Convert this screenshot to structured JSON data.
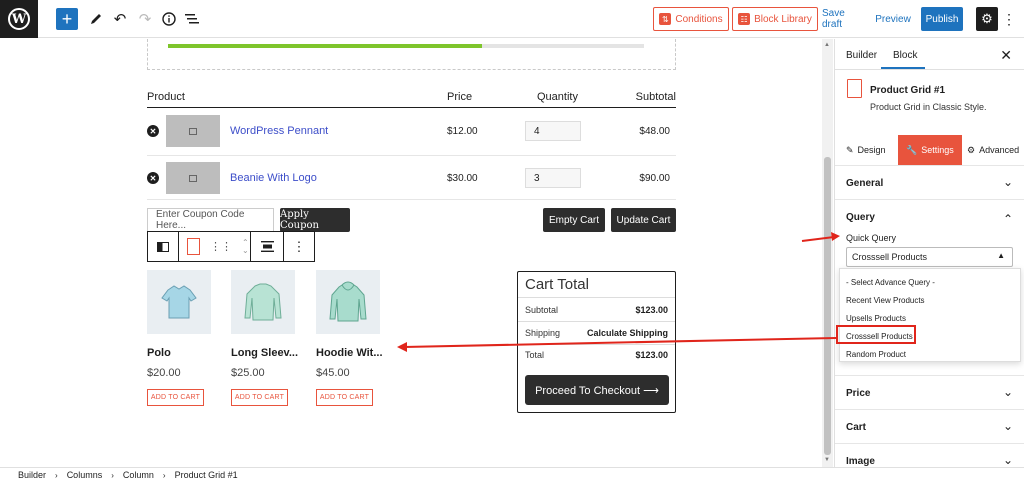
{
  "toolbar": {
    "conditions_label": "Conditions",
    "block_library_label": "Block Library",
    "save_draft_label": "Save draft",
    "preview_label": "Preview",
    "publish_label": "Publish"
  },
  "progress": {
    "fraction": 0.66
  },
  "cart": {
    "headers": {
      "product": "Product",
      "price": "Price",
      "quantity": "Quantity",
      "subtotal": "Subtotal"
    },
    "rows": [
      {
        "name": "WordPress Pennant",
        "price": "$12.00",
        "qty": "4",
        "subtotal": "$48.00"
      },
      {
        "name": "Beanie With Logo",
        "price": "$30.00",
        "qty": "3",
        "subtotal": "$90.00"
      }
    ],
    "coupon_placeholder": "Enter Coupon Code Here...",
    "apply_coupon": "Apply Coupon",
    "empty_cart": "Empty Cart",
    "update_cart": "Update Cart"
  },
  "products": [
    {
      "name": "Polo",
      "price": "$20.00",
      "button": "ADD TO CART"
    },
    {
      "name": "Long Sleev...",
      "price": "$25.00",
      "button": "ADD TO CART"
    },
    {
      "name": "Hoodie Wit...",
      "price": "$45.00",
      "button": "ADD TO CART"
    }
  ],
  "cart_total": {
    "title": "Cart Total",
    "subtotal_label": "Subtotal",
    "subtotal_value": "$123.00",
    "shipping_label": "Shipping",
    "shipping_value": "Calculate Shipping",
    "total_label": "Total",
    "total_value": "$123.00",
    "checkout": "Proceed To Checkout ⟶"
  },
  "sidebar": {
    "tabs": {
      "builder": "Builder",
      "block": "Block"
    },
    "block_title": "Product Grid #1",
    "block_desc": "Product Grid in Classic Style.",
    "inner_tabs": {
      "design": "Design",
      "settings": "Settings",
      "advanced": "Advanced"
    },
    "sections": {
      "general": "General",
      "query": "Query",
      "price": "Price",
      "cart": "Cart",
      "image": "Image"
    },
    "quick_query_label": "Quick Query",
    "quick_query_value": "Crosssell Products",
    "dropdown_options": [
      "- Select Advance Query -",
      "Recent View Products",
      "Upsells Products",
      "Crosssell Products",
      "Random Product"
    ]
  },
  "breadcrumb": [
    "Builder",
    "Columns",
    "Column",
    "Product Grid #1"
  ],
  "colors": {
    "accent": "#e8543d",
    "primary": "#1e73be",
    "progress": "#7ec52b",
    "arrow": "#e0251b"
  }
}
